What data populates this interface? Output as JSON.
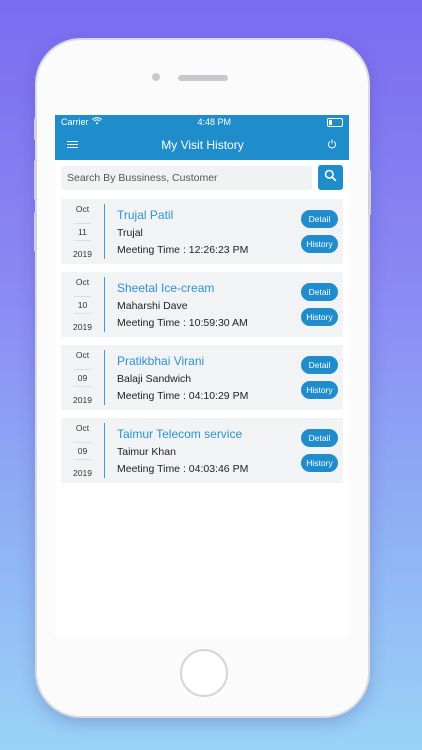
{
  "status": {
    "carrier": "Carrier",
    "time": "4:48 PM"
  },
  "nav": {
    "title": "My Visit History"
  },
  "search": {
    "placeholder": "Search By Bussiness, Customer"
  },
  "visits": [
    {
      "month": "Oct",
      "day": "11",
      "year": "2019",
      "business": "Trujal Patil",
      "customer": "Trujal",
      "meeting": "Meeting Time : 12:26:23 PM",
      "detail": "Detail",
      "history": "History"
    },
    {
      "month": "Oct",
      "day": "10",
      "year": "2019",
      "business": "Sheetal Ice-cream",
      "customer": "Maharshi Dave",
      "meeting": "Meeting Time : 10:59:30 AM",
      "detail": "Detail",
      "history": "History"
    },
    {
      "month": "Oct",
      "day": "09",
      "year": "2019",
      "business": "Pratikbhai Virani",
      "customer": "Balaji Sandwich",
      "meeting": "Meeting Time : 04:10:29 PM",
      "detail": "Detail",
      "history": "History"
    },
    {
      "month": "Oct",
      "day": "09",
      "year": "2019",
      "business": "Taimur Telecom service",
      "customer": "Taimur Khan",
      "meeting": "Meeting Time : 04:03:46 PM",
      "detail": "Detail",
      "history": "History"
    }
  ],
  "icons": {
    "menu": "hamburger-icon",
    "power": "power-icon",
    "search": "search-icon",
    "wifi": "wifi-icon",
    "battery": "battery-icon"
  },
  "colors": {
    "primary": "#1f8ccc",
    "business_text": "#2a93d0",
    "card_bg": "#f2f3f5"
  }
}
